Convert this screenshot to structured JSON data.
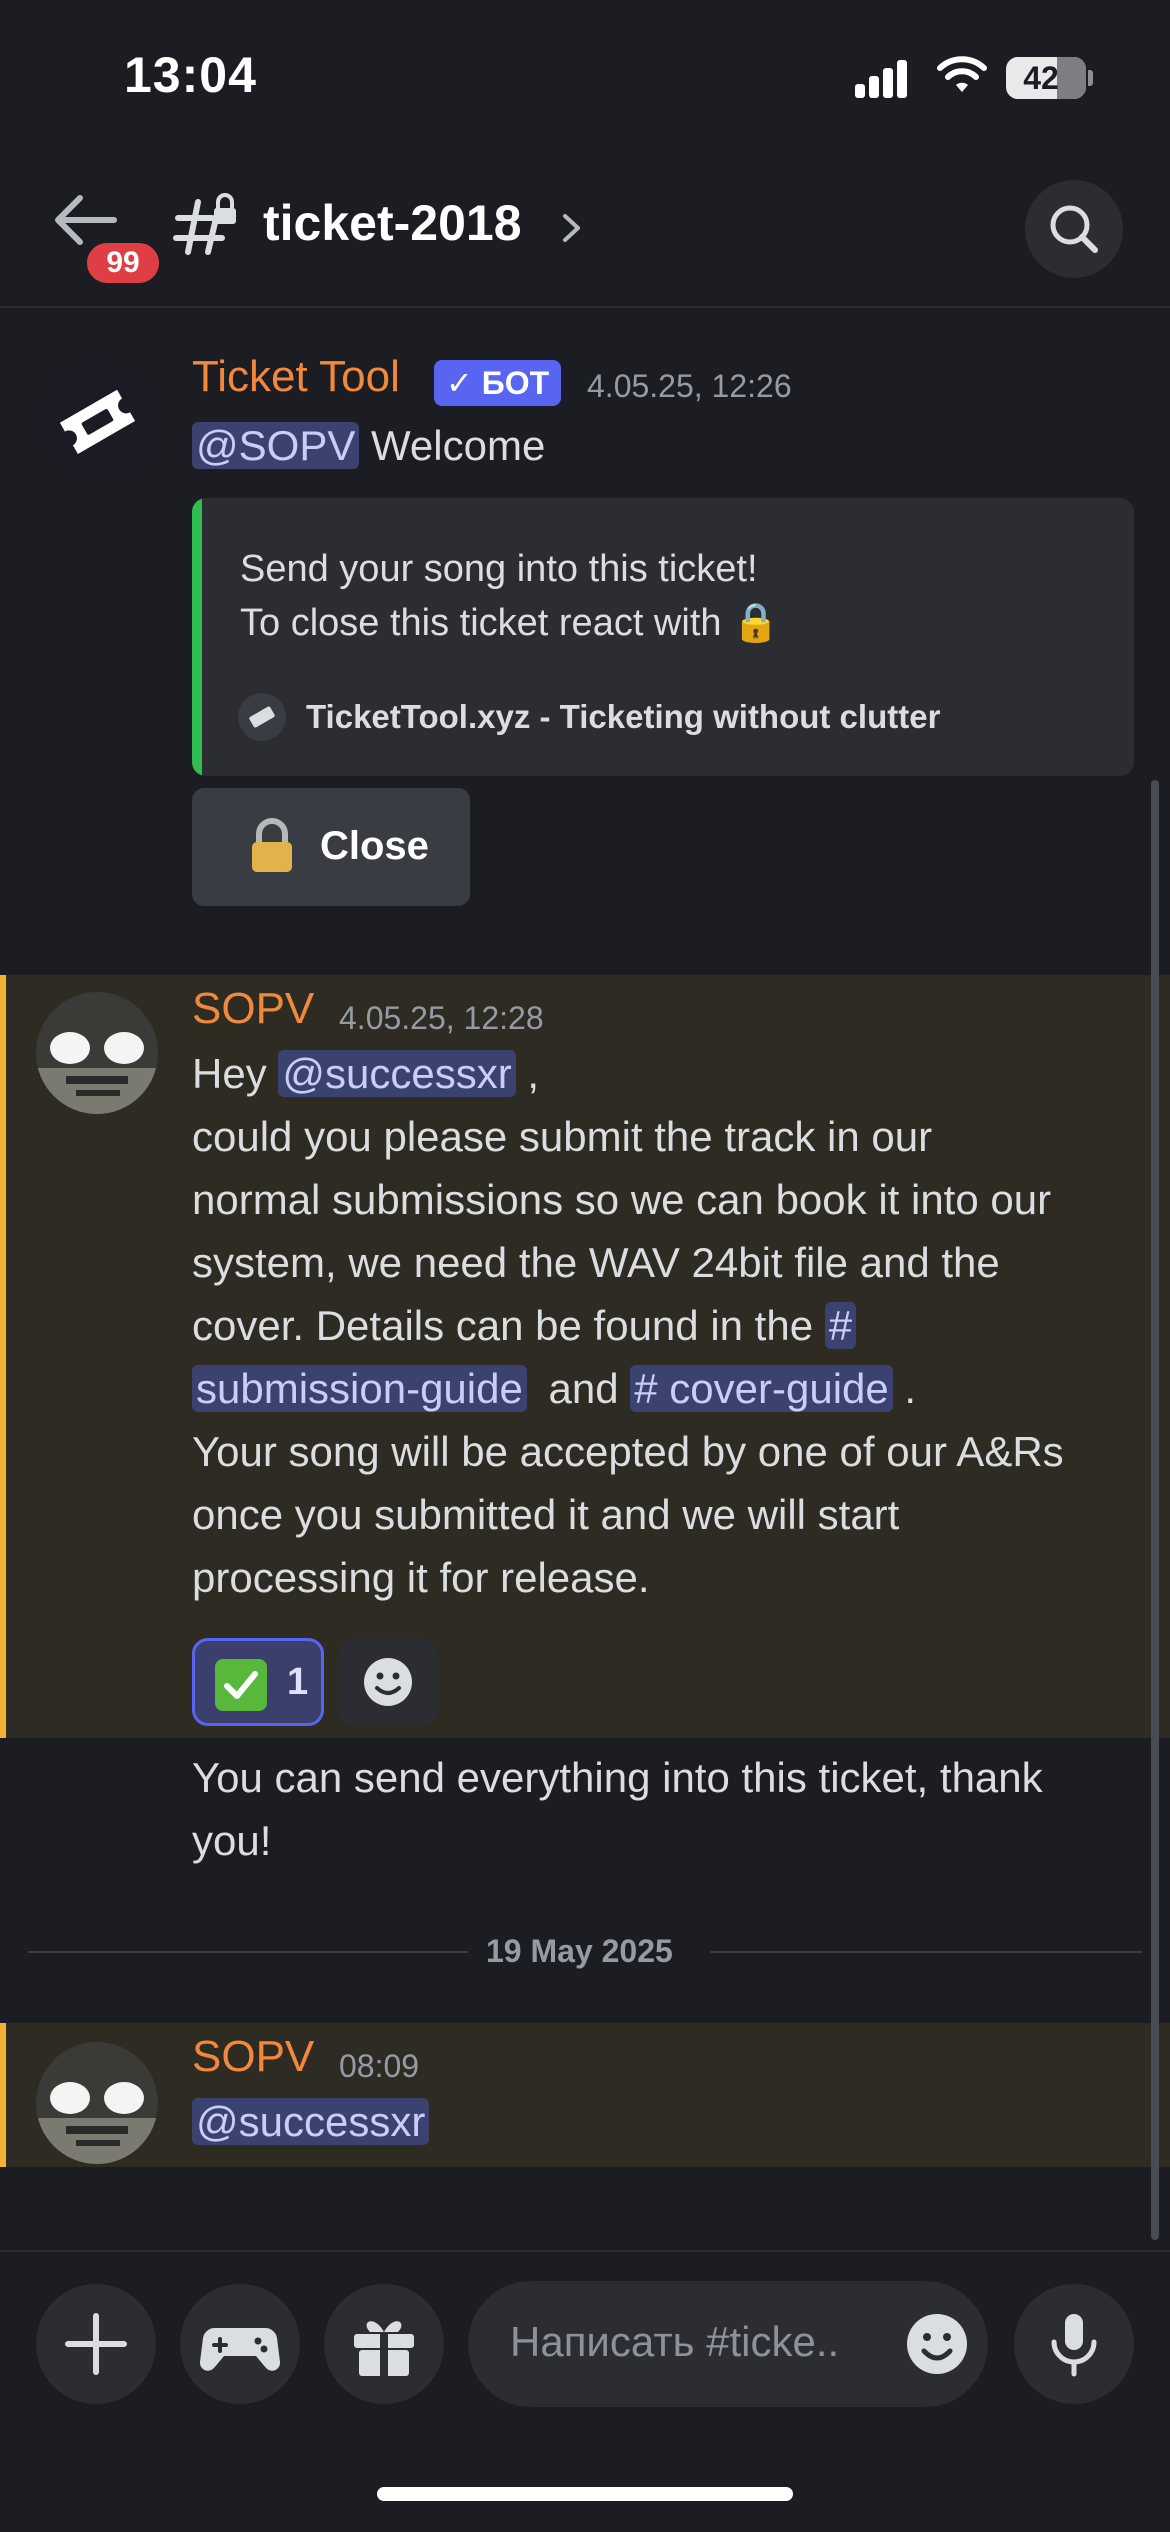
{
  "status_bar": {
    "time": "13:04",
    "battery": "42"
  },
  "header": {
    "badge_count": "99",
    "channel": "ticket-2018"
  },
  "messages": [
    {
      "author": "Ticket Tool",
      "bot_tag": "✓ БОТ",
      "timestamp": "4.05.25, 12:26",
      "mention": "@SOPV",
      "text": "Welcome",
      "embed": {
        "line1": "Send your song into this ticket!",
        "line2": "To close this ticket react with 🔒",
        "footer": "TicketTool.xyz - Ticketing without clutter"
      },
      "button_label": "Close"
    },
    {
      "author": "SOPV",
      "timestamp": "4.05.25, 12:28",
      "hey": "Hey",
      "mention": "@successxr",
      "comma": ",",
      "body1": "could you please submit the track in our",
      "body2": "normal submissions so we can book it into our",
      "body3": "system, we need the WAV 24bit file and the",
      "body4": "cover. Details can be found in the",
      "channel1_hash": "#",
      "channel1": "submission-guide",
      "and": "and",
      "channel2": "# cover-guide",
      "period": ".",
      "body5": "Your song will be accepted by one of our A&Rs",
      "body6": "once you submitted it and we will start",
      "body7": "processing it for release.",
      "reaction_count": "1",
      "followup1": "You can send everything into this ticket, thank",
      "followup2": "you!"
    },
    {
      "author": "SOPV",
      "timestamp": "08:09",
      "mention": "@successxr"
    }
  ],
  "date_divider": "19 May 2025",
  "composer": {
    "placeholder": "Написать #ticke.."
  },
  "colors": {
    "accent": "#5865f2",
    "author": "#f0883e",
    "highlight": "#f0b232",
    "embed_bar": "#2fbd52"
  },
  "icons": [
    "back-arrow-icon",
    "locked-channel-icon",
    "search-icon",
    "plus-icon",
    "gamepad-icon",
    "gift-icon",
    "emoji-icon",
    "microphone-icon",
    "lock-icon",
    "ticket-icon"
  ]
}
